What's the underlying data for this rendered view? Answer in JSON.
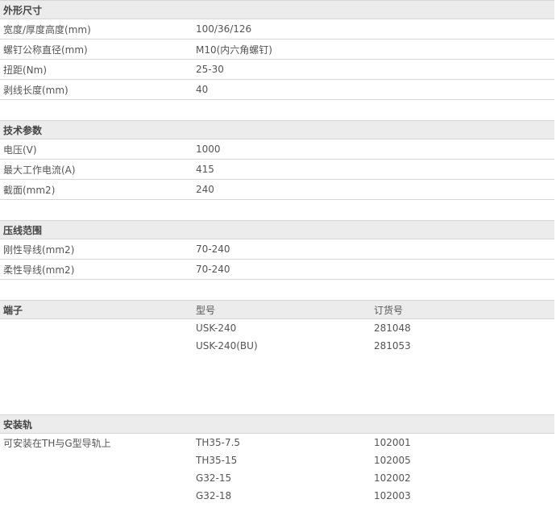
{
  "sections": {
    "dimensions": {
      "title": "外形尺寸",
      "rows": [
        {
          "label": "宽度/厚度高度(mm)",
          "value": "100/36/126"
        },
        {
          "label": "螺钉公称直径(mm)",
          "value": "M10(内六角螺钉)"
        },
        {
          "label": "扭距(Nm)",
          "value": "25-30"
        },
        {
          "label": "剥线长度(mm)",
          "value": "40"
        }
      ]
    },
    "technical": {
      "title": "技术参数",
      "rows": [
        {
          "label": "电压(V)",
          "value": "1000"
        },
        {
          "label": "最大工作电流(A)",
          "value": "415"
        },
        {
          "label": "截面(mm2)",
          "value": "240"
        }
      ]
    },
    "crimp_range": {
      "title": "压线范围",
      "rows": [
        {
          "label": "刚性导线(mm2)",
          "value": "70-240"
        },
        {
          "label": "柔性导线(mm2)",
          "value": "70-240"
        }
      ]
    },
    "terminals": {
      "title": "端子",
      "col_model": "型号",
      "col_order": "订货号",
      "rows": [
        {
          "model": "USK-240",
          "order": "281048"
        },
        {
          "model": "USK-240(BU)",
          "order": "281053"
        }
      ]
    },
    "rail": {
      "title": "安装轨",
      "description": "可安装在TH与G型导轨上",
      "rows": [
        {
          "model": "TH35-7.5",
          "order": "102001"
        },
        {
          "model": "TH35-15",
          "order": "102005"
        },
        {
          "model": "G32-15",
          "order": "102002"
        },
        {
          "model": "G32-18",
          "order": "102003"
        }
      ]
    }
  }
}
